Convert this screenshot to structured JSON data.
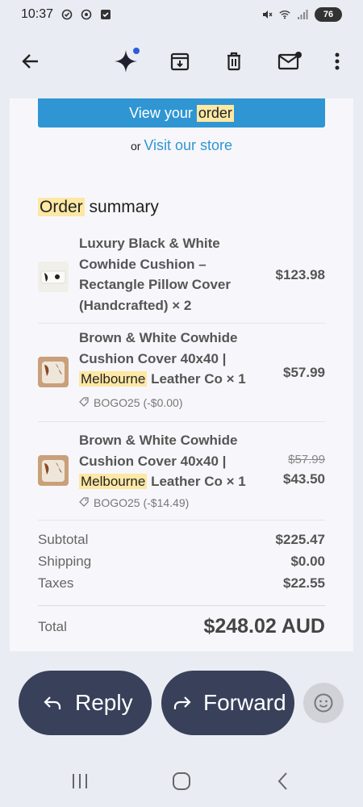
{
  "status": {
    "time": "10:37",
    "battery": "76"
  },
  "toolbar": {
    "icons": [
      "back-arrow-icon",
      "gemini-sparkle-icon",
      "archive-icon",
      "delete-icon",
      "mark-unread-icon",
      "more-vert-icon"
    ]
  },
  "email": {
    "view_order_prefix": "View your ",
    "view_order_highlight": "order",
    "or_text": "or",
    "visit_store": "Visit our store",
    "summary_highlight": "Order",
    "summary_rest": " summary",
    "items": [
      {
        "title": "Luxury Black & White Cowhide Cushion – Rectangle Pillow Cover (Handcrafted) × 2",
        "price": "$123.98"
      },
      {
        "title_a": "Brown & White Cowhide Cushion Cover 40x40 |",
        "title_highlight": "Melbourne",
        "title_b": "Leather Co × 1",
        "discount": "BOGO25 (-$0.00)",
        "price": "$57.99"
      },
      {
        "title_a": "Brown & White Cowhide Cushion Cover 40x40 |",
        "title_highlight": "Melbourne",
        "title_b": "Leather Co × 1",
        "discount": "BOGO25 (-$14.49)",
        "original_price": "$57.99",
        "price": "$43.50"
      }
    ],
    "subtotal_label": "Subtotal",
    "subtotal_value": "$225.47",
    "shipping_label": "Shipping",
    "shipping_value": "$0.00",
    "taxes_label": "Taxes",
    "taxes_value": "$22.55",
    "total_label": "Total",
    "total_value": "$248.02 AUD"
  },
  "actions": {
    "reply_label": "Reply",
    "forward_label": "Forward"
  },
  "colors": {
    "accent": "#2f96d3",
    "highlight": "#fde8a4",
    "pill": "#38405a"
  }
}
